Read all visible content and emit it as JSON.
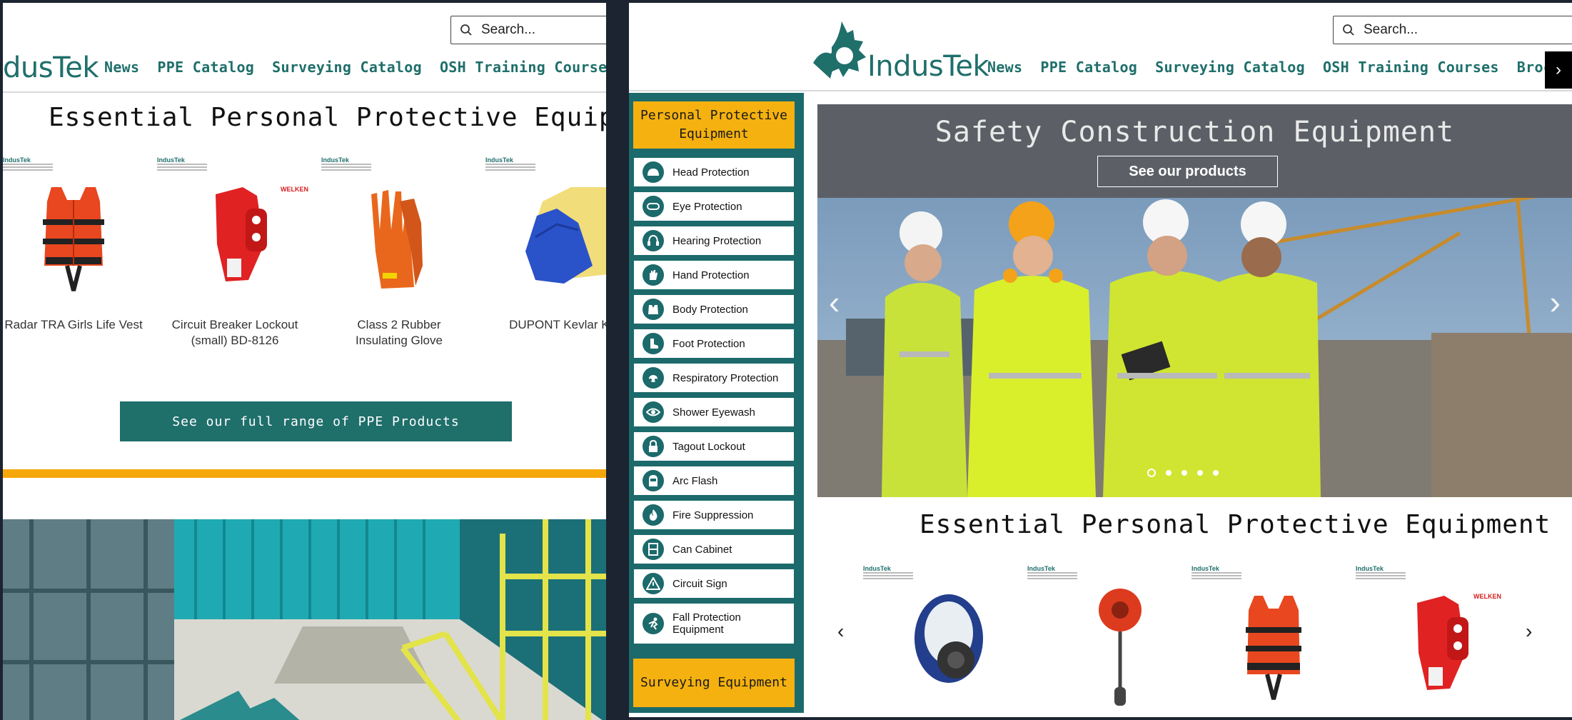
{
  "left_window": {
    "logo_text": "dusTek",
    "search": {
      "placeholder": "Search..."
    },
    "nav": [
      "News",
      "PPE Catalog",
      "Surveying Catalog",
      "OSH Training Courses"
    ],
    "section_title": "Essential Personal Protective Equipment",
    "products": [
      {
        "name": "Radar TRA Girls Life Vest"
      },
      {
        "name": "Circuit Breaker Lockout (small) BD-8126",
        "brand": "WELKEN"
      },
      {
        "name": "Class 2 Rubber Insulating Glove"
      },
      {
        "name": "DUPONT Kevlar KK"
      }
    ],
    "cta_label": "See our full range of PPE Products"
  },
  "right_window": {
    "logo_text": "IndusTek",
    "search": {
      "placeholder": "Search..."
    },
    "nav": [
      "News",
      "PPE Catalog",
      "Surveying Catalog",
      "OSH Training Courses",
      "Broch"
    ],
    "sidebar": {
      "head": "Personal Protective Equipment",
      "items": [
        {
          "label": "Head Protection",
          "icon": "hard-hat-icon"
        },
        {
          "label": "Eye Protection",
          "icon": "goggles-icon"
        },
        {
          "label": "Hearing Protection",
          "icon": "earmuffs-icon"
        },
        {
          "label": "Hand Protection",
          "icon": "glove-icon"
        },
        {
          "label": "Body Protection",
          "icon": "vest-icon"
        },
        {
          "label": "Foot Protection",
          "icon": "boot-icon"
        },
        {
          "label": "Respiratory Protection",
          "icon": "respirator-icon"
        },
        {
          "label": "Shower Eyewash",
          "icon": "eye-icon"
        },
        {
          "label": "Tagout Lockout",
          "icon": "padlock-icon"
        },
        {
          "label": "Arc Flash",
          "icon": "arc-flash-hood-icon"
        },
        {
          "label": "Fire Suppression",
          "icon": "flame-icon"
        },
        {
          "label": "Can Cabinet",
          "icon": "cabinet-icon"
        },
        {
          "label": "Circuit Sign",
          "icon": "warning-sign-icon"
        },
        {
          "label": "Fall Protection Equipment",
          "icon": "falling-person-icon"
        }
      ],
      "footer": "Surveying Equipment"
    },
    "hero": {
      "title": "Safety Construction Equipment",
      "button": "See our products",
      "slide_count": 5,
      "active_slide": 1
    },
    "section_title": "Essential Personal Protective Equipment",
    "carousel_brand": "WELKEN",
    "colors": {
      "brand_teal": "#1f6f6b",
      "accent_orange": "#f5a70a",
      "hero_band": "#5c6066"
    }
  }
}
